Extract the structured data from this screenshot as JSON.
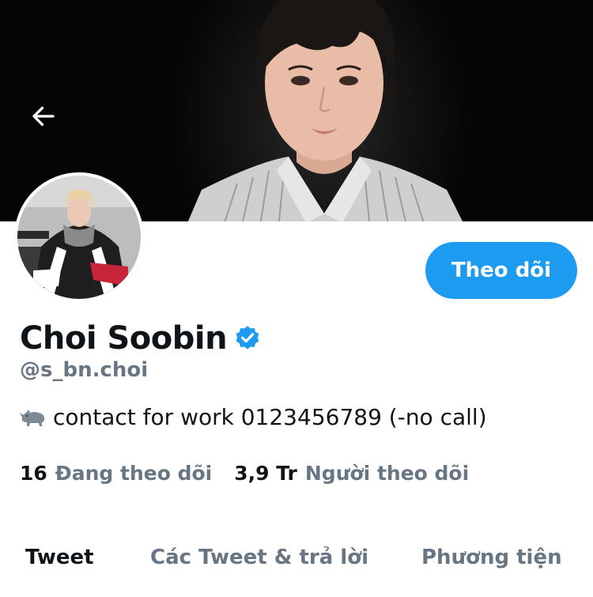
{
  "profile": {
    "display_name": "Choi Soobin",
    "handle": "@s_bn.choi",
    "verified": true,
    "bio_emoji": "rhino",
    "bio_text": "contact for work 0123456789 (-no call)",
    "follow_label": "Theo dõi"
  },
  "stats": {
    "following_count": "16",
    "following_label": "Đang theo dõi",
    "followers_count": "3,9 Tr",
    "followers_label": "Người theo dõi"
  },
  "tabs": [
    {
      "label": "Tweet",
      "active": true
    },
    {
      "label": "Các Tweet & trả lời",
      "active": false
    },
    {
      "label": "Phương tiện",
      "active": false
    }
  ],
  "icons": {
    "back": "arrow-left-icon",
    "verified": "verified-badge-icon"
  },
  "colors": {
    "accent": "#1d9bf0",
    "text_primary": "#0f1419",
    "text_secondary": "#687684",
    "banner": "#0a0a0a"
  }
}
